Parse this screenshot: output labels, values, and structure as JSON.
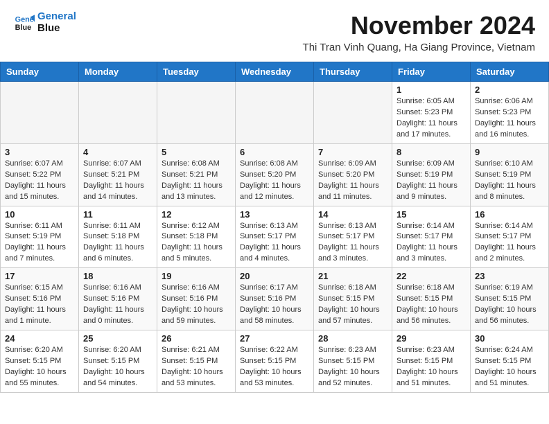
{
  "header": {
    "logo_line1": "General",
    "logo_line2": "Blue",
    "month_title": "November 2024",
    "subtitle": "Thi Tran Vinh Quang, Ha Giang Province, Vietnam"
  },
  "weekdays": [
    "Sunday",
    "Monday",
    "Tuesday",
    "Wednesday",
    "Thursday",
    "Friday",
    "Saturday"
  ],
  "weeks": [
    [
      {
        "num": "",
        "info": ""
      },
      {
        "num": "",
        "info": ""
      },
      {
        "num": "",
        "info": ""
      },
      {
        "num": "",
        "info": ""
      },
      {
        "num": "",
        "info": ""
      },
      {
        "num": "1",
        "info": "Sunrise: 6:05 AM\nSunset: 5:23 PM\nDaylight: 11 hours and 17 minutes."
      },
      {
        "num": "2",
        "info": "Sunrise: 6:06 AM\nSunset: 5:23 PM\nDaylight: 11 hours and 16 minutes."
      }
    ],
    [
      {
        "num": "3",
        "info": "Sunrise: 6:07 AM\nSunset: 5:22 PM\nDaylight: 11 hours and 15 minutes."
      },
      {
        "num": "4",
        "info": "Sunrise: 6:07 AM\nSunset: 5:21 PM\nDaylight: 11 hours and 14 minutes."
      },
      {
        "num": "5",
        "info": "Sunrise: 6:08 AM\nSunset: 5:21 PM\nDaylight: 11 hours and 13 minutes."
      },
      {
        "num": "6",
        "info": "Sunrise: 6:08 AM\nSunset: 5:20 PM\nDaylight: 11 hours and 12 minutes."
      },
      {
        "num": "7",
        "info": "Sunrise: 6:09 AM\nSunset: 5:20 PM\nDaylight: 11 hours and 11 minutes."
      },
      {
        "num": "8",
        "info": "Sunrise: 6:09 AM\nSunset: 5:19 PM\nDaylight: 11 hours and 9 minutes."
      },
      {
        "num": "9",
        "info": "Sunrise: 6:10 AM\nSunset: 5:19 PM\nDaylight: 11 hours and 8 minutes."
      }
    ],
    [
      {
        "num": "10",
        "info": "Sunrise: 6:11 AM\nSunset: 5:19 PM\nDaylight: 11 hours and 7 minutes."
      },
      {
        "num": "11",
        "info": "Sunrise: 6:11 AM\nSunset: 5:18 PM\nDaylight: 11 hours and 6 minutes."
      },
      {
        "num": "12",
        "info": "Sunrise: 6:12 AM\nSunset: 5:18 PM\nDaylight: 11 hours and 5 minutes."
      },
      {
        "num": "13",
        "info": "Sunrise: 6:13 AM\nSunset: 5:17 PM\nDaylight: 11 hours and 4 minutes."
      },
      {
        "num": "14",
        "info": "Sunrise: 6:13 AM\nSunset: 5:17 PM\nDaylight: 11 hours and 3 minutes."
      },
      {
        "num": "15",
        "info": "Sunrise: 6:14 AM\nSunset: 5:17 PM\nDaylight: 11 hours and 3 minutes."
      },
      {
        "num": "16",
        "info": "Sunrise: 6:14 AM\nSunset: 5:17 PM\nDaylight: 11 hours and 2 minutes."
      }
    ],
    [
      {
        "num": "17",
        "info": "Sunrise: 6:15 AM\nSunset: 5:16 PM\nDaylight: 11 hours and 1 minute."
      },
      {
        "num": "18",
        "info": "Sunrise: 6:16 AM\nSunset: 5:16 PM\nDaylight: 11 hours and 0 minutes."
      },
      {
        "num": "19",
        "info": "Sunrise: 6:16 AM\nSunset: 5:16 PM\nDaylight: 10 hours and 59 minutes."
      },
      {
        "num": "20",
        "info": "Sunrise: 6:17 AM\nSunset: 5:16 PM\nDaylight: 10 hours and 58 minutes."
      },
      {
        "num": "21",
        "info": "Sunrise: 6:18 AM\nSunset: 5:15 PM\nDaylight: 10 hours and 57 minutes."
      },
      {
        "num": "22",
        "info": "Sunrise: 6:18 AM\nSunset: 5:15 PM\nDaylight: 10 hours and 56 minutes."
      },
      {
        "num": "23",
        "info": "Sunrise: 6:19 AM\nSunset: 5:15 PM\nDaylight: 10 hours and 56 minutes."
      }
    ],
    [
      {
        "num": "24",
        "info": "Sunrise: 6:20 AM\nSunset: 5:15 PM\nDaylight: 10 hours and 55 minutes."
      },
      {
        "num": "25",
        "info": "Sunrise: 6:20 AM\nSunset: 5:15 PM\nDaylight: 10 hours and 54 minutes."
      },
      {
        "num": "26",
        "info": "Sunrise: 6:21 AM\nSunset: 5:15 PM\nDaylight: 10 hours and 53 minutes."
      },
      {
        "num": "27",
        "info": "Sunrise: 6:22 AM\nSunset: 5:15 PM\nDaylight: 10 hours and 53 minutes."
      },
      {
        "num": "28",
        "info": "Sunrise: 6:23 AM\nSunset: 5:15 PM\nDaylight: 10 hours and 52 minutes."
      },
      {
        "num": "29",
        "info": "Sunrise: 6:23 AM\nSunset: 5:15 PM\nDaylight: 10 hours and 51 minutes."
      },
      {
        "num": "30",
        "info": "Sunrise: 6:24 AM\nSunset: 5:15 PM\nDaylight: 10 hours and 51 minutes."
      }
    ]
  ]
}
